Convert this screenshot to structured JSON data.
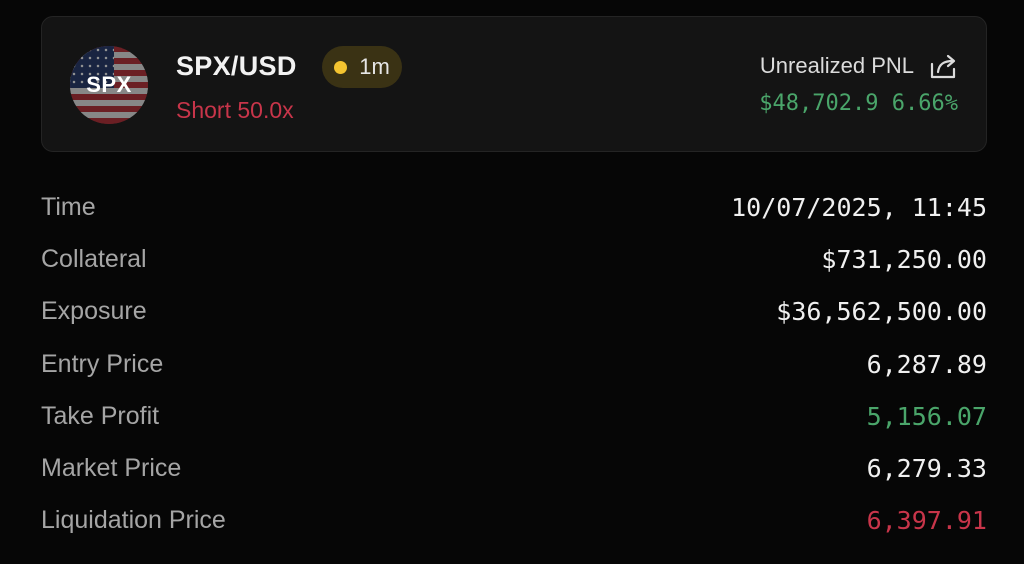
{
  "header": {
    "avatar_text": "SPX",
    "pair": "SPX/USD",
    "timeframe": "1m",
    "side": "Short 50.0x",
    "pnl_label": "Unrealized PNL",
    "pnl_amount": "$48,702.9",
    "pnl_percent": "6.66%",
    "icons": {
      "share": "share-icon",
      "timeframe_dot": "status-dot-icon"
    },
    "colors": {
      "positive": "#4aa56a",
      "negative": "#c8354a",
      "badge_dot": "#f4c430"
    }
  },
  "details": [
    {
      "label": "Time",
      "value": "10/07/2025, 11:45",
      "tone": "neutral"
    },
    {
      "label": "Collateral",
      "value": "$731,250.00",
      "tone": "neutral"
    },
    {
      "label": "Exposure",
      "value": "$36,562,500.00",
      "tone": "neutral"
    },
    {
      "label": "Entry Price",
      "value": "6,287.89",
      "tone": "neutral"
    },
    {
      "label": "Take Profit",
      "value": "5,156.07",
      "tone": "positive"
    },
    {
      "label": "Market Price",
      "value": "6,279.33",
      "tone": "neutral"
    },
    {
      "label": "Liquidation Price",
      "value": "6,397.91",
      "tone": "negative"
    }
  ]
}
